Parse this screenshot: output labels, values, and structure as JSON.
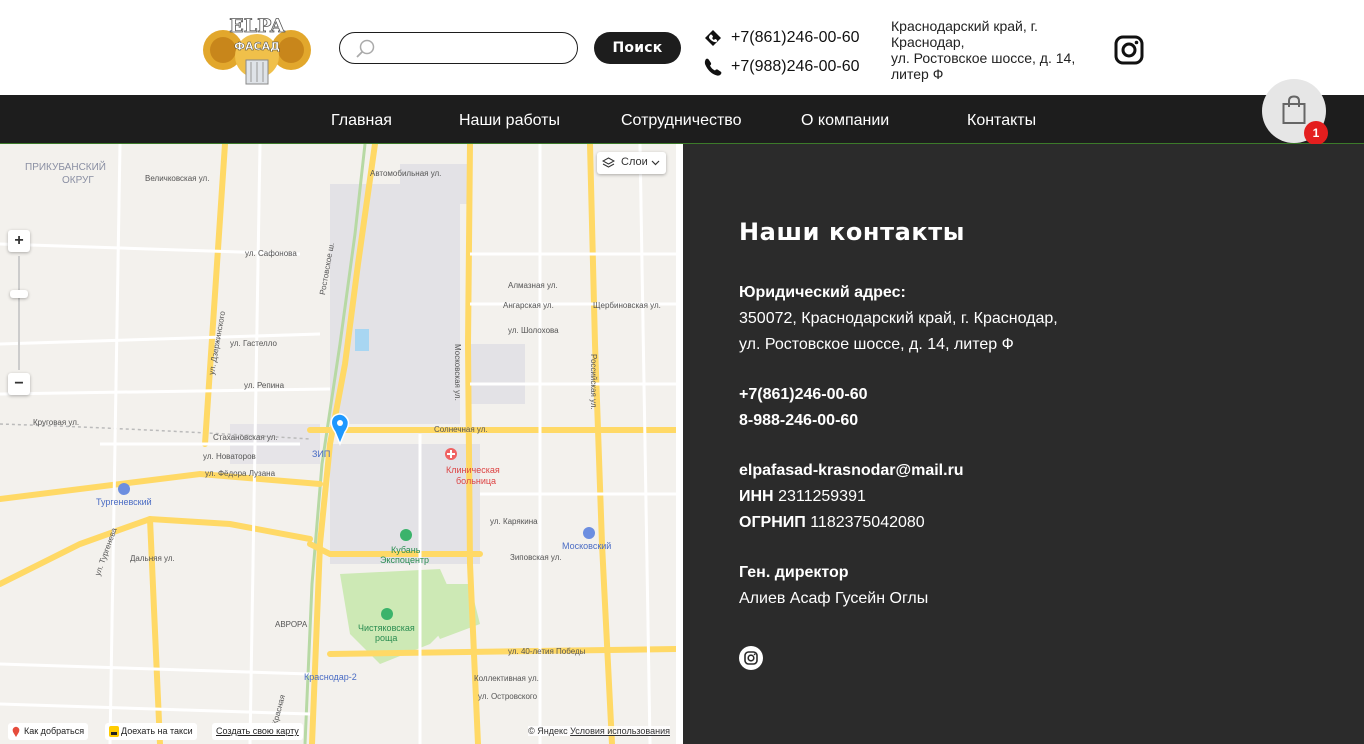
{
  "logo": {
    "text": "ELPAФАСАД"
  },
  "search": {
    "placeholder": "",
    "button_label": "Поиск"
  },
  "phones": [
    "+7(861)246-00-60",
    "+7(988)246-00-60"
  ],
  "address": {
    "line1": "Краснодарский край, г.",
    "line2": "Краснодар,",
    "line3": "ул. Ростовское шоссе, д. 14,",
    "line4": "литер Ф"
  },
  "nav": {
    "items": [
      {
        "label": "Главная"
      },
      {
        "label": "Наши работы"
      },
      {
        "label": "Сотрудничество"
      },
      {
        "label": "О компании"
      },
      {
        "label": "Контакты"
      }
    ]
  },
  "cart": {
    "count": "1"
  },
  "map": {
    "layers_label": "Слои",
    "zoom_in": "+",
    "zoom_out": "−",
    "labels": {
      "district": "ПРИКУБАНСКИЙ",
      "district2": "ОКРУГ",
      "hospital1": "Клиническая",
      "hospital2": "больница",
      "expo1": "Кубань",
      "expo2": "Экспоцентр",
      "grove1": "Чистяковская",
      "grove2": "роща",
      "turgenevsky": "Тургеневский",
      "moskovsky": "Московский",
      "avrora": "АВРОРА",
      "zip": "ЗИП",
      "krasnodar2": "Краснодар-2",
      "solnechnaya": "Солнечная ул.",
      "rostovskoe": "Ростовское ш.",
      "moskovskaya": "Московская ул.",
      "rossiyskaya": "Российская ул.",
      "pobedy": "ул. 40-летия Победы",
      "dzerzhinskogo": "ул. Дзержинского",
      "repina": "ул. Репина",
      "gastello": "ул. Гастелло",
      "safonova": "ул. Сафонова",
      "zipovskaya": "Зиповская ул.",
      "karyakina": "ул. Карякина",
      "dalnyaya": "Дальняя ул.",
      "turgeneva": "ул. Тургенева",
      "novatorov": "ул. Новаторов",
      "luzana": "ул. Фёдора Лузана",
      "stakhanovskaya": "Стахановская ул.",
      "krugovaya": "Круговая ул.",
      "avtomobilnaya": "Автомобильная ул.",
      "almaznaya": "Алмазная ул.",
      "angarskaya": "Ангарская ул.",
      "sherbinovskaya": "Щербиновская ул.",
      "sholokhova": "ул. Шолохова",
      "velichkovskaya": "Величковская ул.",
      "kollektivnaya": "Коллективная ул.",
      "ostrovskogo": "ул. Островского",
      "krasnaya": "ул. Красная"
    },
    "footer": {
      "route": "Как добраться",
      "taxi": "Доехать на такси",
      "create": "Создать свою карту",
      "copyright": "© Яндекс",
      "terms": "Условия использования"
    }
  },
  "contacts": {
    "title": "Наши контакты",
    "legal_label": "Юридический адрес:",
    "legal_line1": "350072, Краснодарский край, г. Краснодар,",
    "legal_line2": "ул. Ростовское шоссе, д. 14, литер Ф",
    "phone1": "+7(861)246-00-60",
    "phone2": "8-988-246-00-60",
    "email": "elpafasad-krasnodar@mail.ru",
    "inn_label": "ИНН",
    "inn_value": "2311259391",
    "ogrnip_label": "ОГРНИП",
    "ogrnip_value": "1182375042080",
    "director_label": "Ген. директор",
    "director_name": "Алиев Асаф Гусейн Оглы"
  },
  "colors": {
    "dark": "#1d1d1d",
    "panel": "#2b2b2b",
    "badge": "#e41e1e",
    "logo_gold": "#e2a72c",
    "map_road": "#ffd966",
    "map_park": "#cde9b5"
  }
}
